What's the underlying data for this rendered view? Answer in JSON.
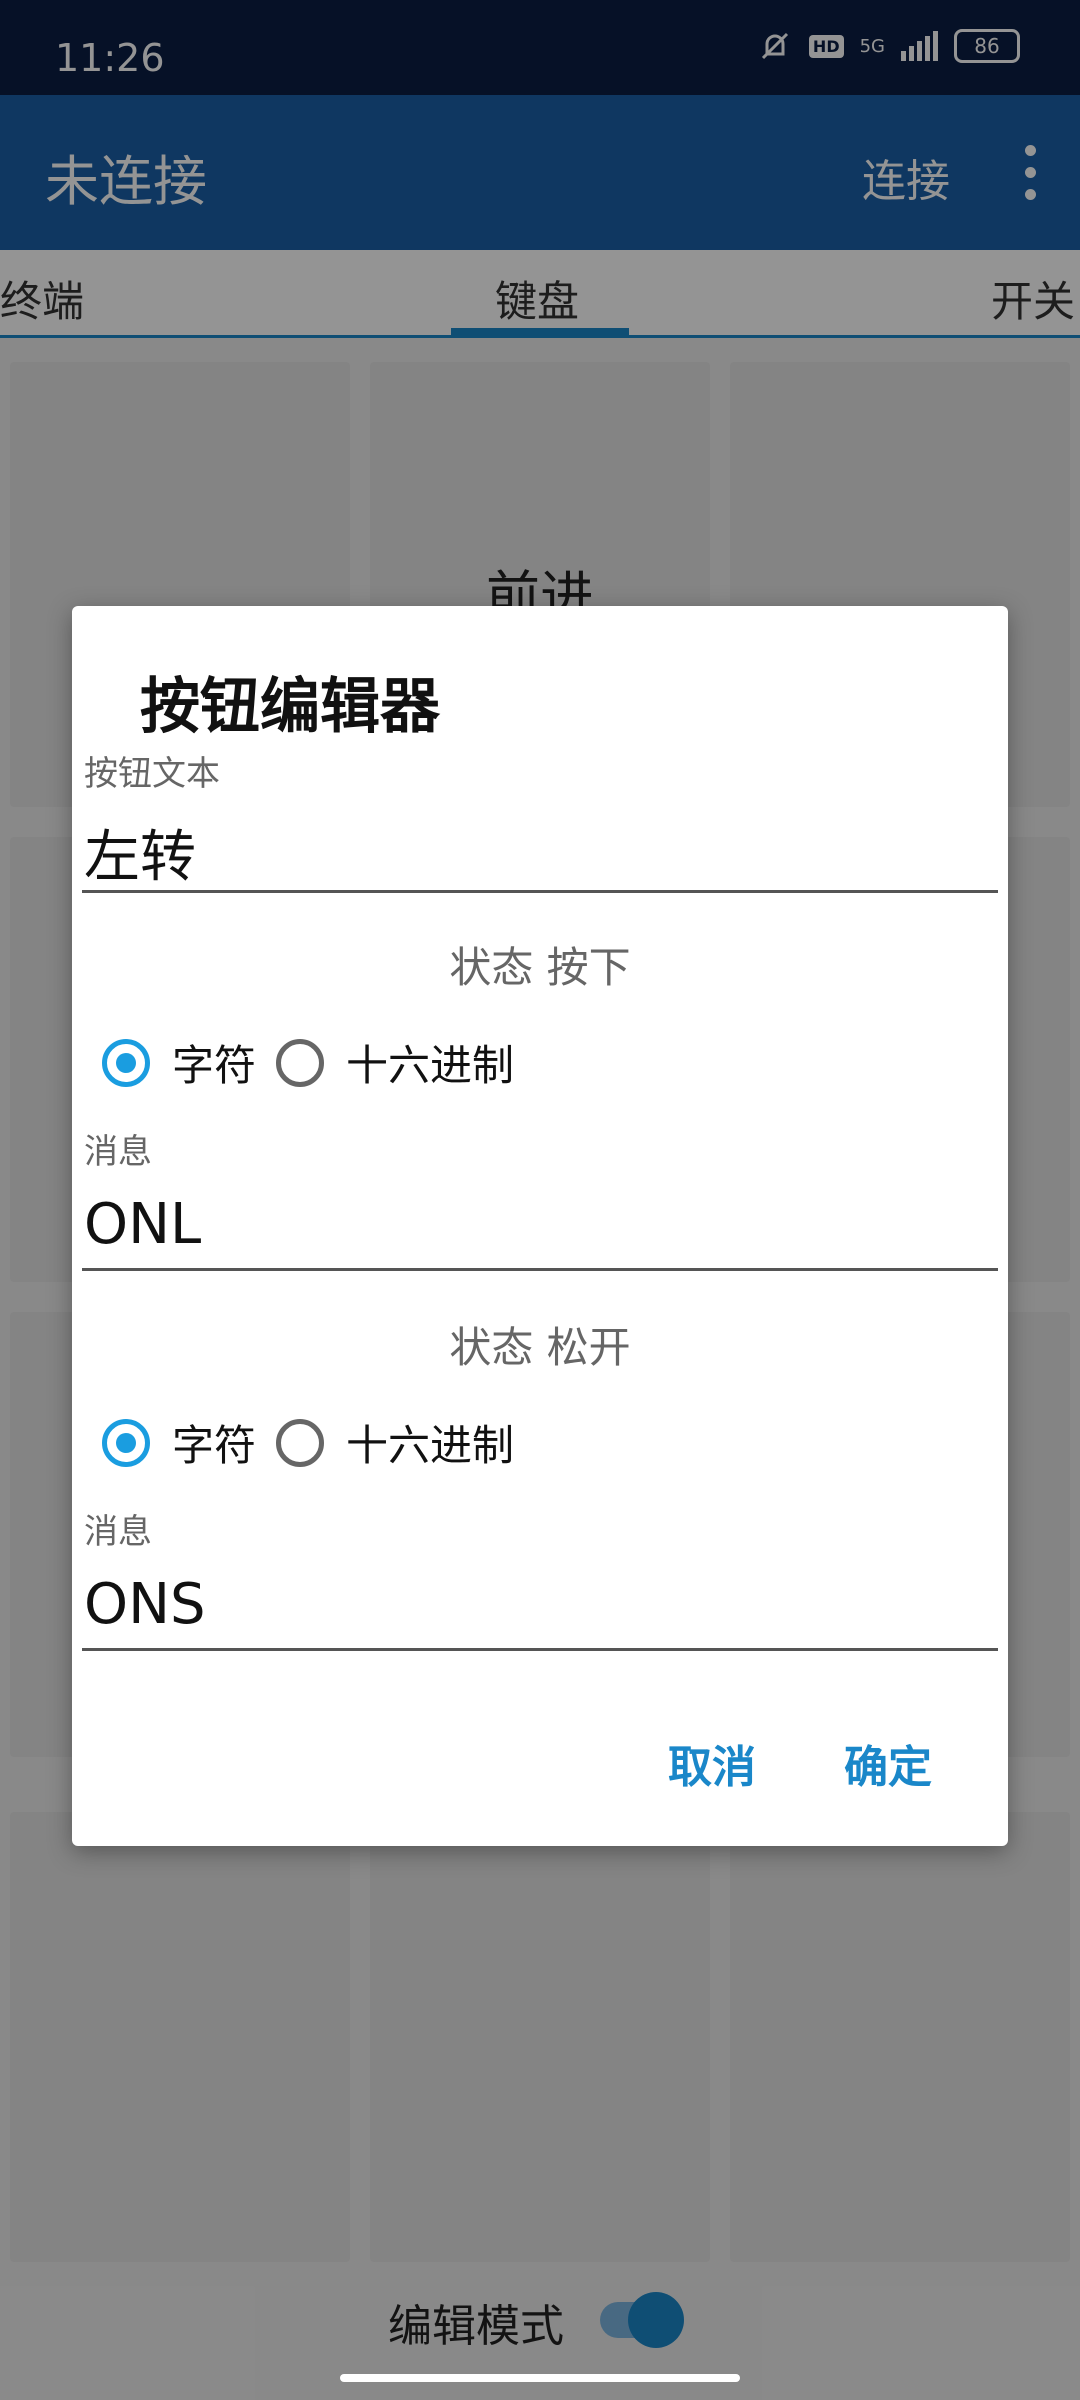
{
  "status_bar": {
    "time": "11:26",
    "network": "5G",
    "hd": "HD",
    "battery": "86"
  },
  "app_bar": {
    "title": "未连接",
    "connect_label": "连接"
  },
  "tabs": {
    "left": "终端",
    "center": "键盘",
    "right": "开关"
  },
  "grid": {
    "top_center_label": "前进"
  },
  "bottom": {
    "edit_mode_label": "编辑模式",
    "edit_mode_on": true
  },
  "dialog": {
    "title": "按钮编辑器",
    "button_text_label": "按钮文本",
    "button_text_value": "左转",
    "pressed": {
      "title": "状态 按下",
      "option_char": "字符",
      "option_hex": "十六进制",
      "selected": "字符",
      "message_label": "消息",
      "message_value": "ONL"
    },
    "released": {
      "title": "状态 松开",
      "option_char": "字符",
      "option_hex": "十六进制",
      "selected": "字符",
      "message_label": "消息",
      "message_value": "ONS"
    },
    "cancel_label": "取消",
    "ok_label": "确定"
  },
  "colors": {
    "accent": "#1a87c9",
    "app_bar": "#1a5fa7",
    "status_bar": "#0b1e44"
  }
}
